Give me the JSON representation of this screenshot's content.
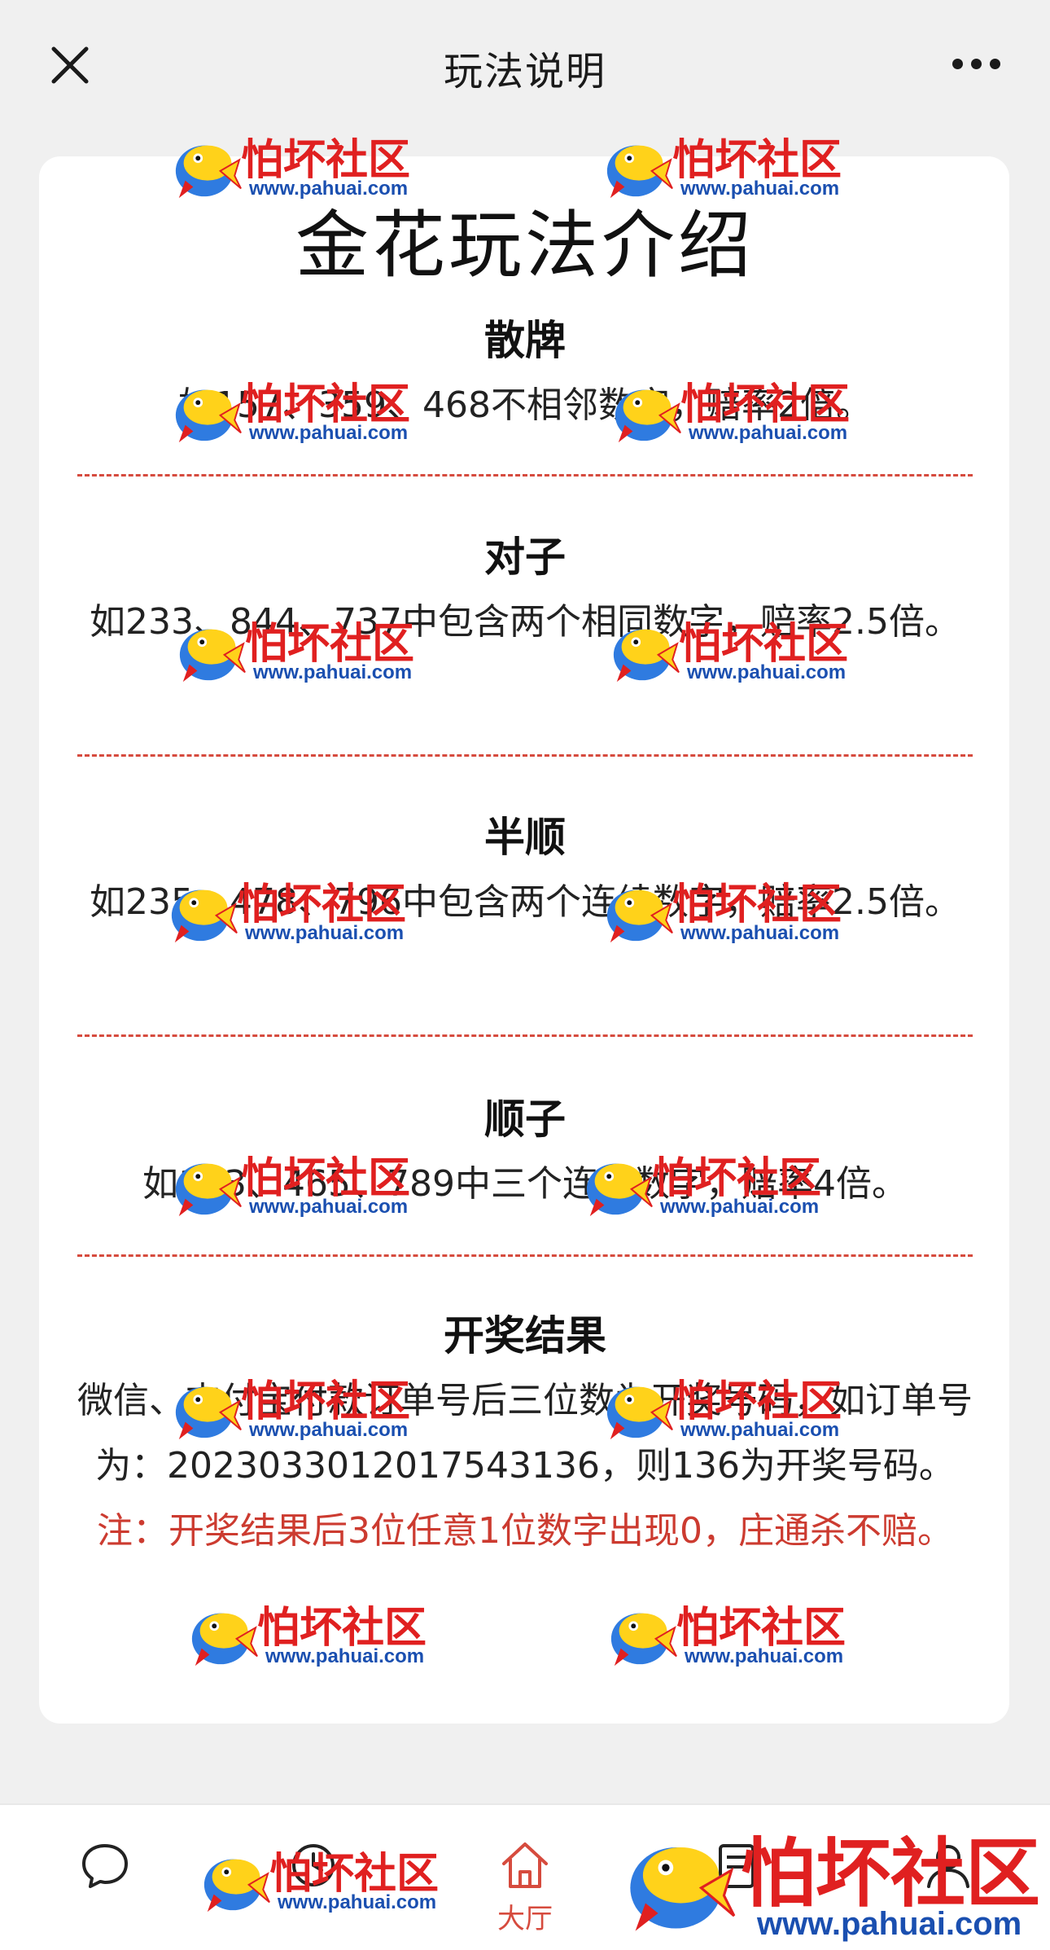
{
  "topbar": {
    "title": "玩法说明"
  },
  "main_title": "金花玩法介绍",
  "sections": [
    {
      "heading": "散牌",
      "body": "如157、359、468不相邻数字，赔率2倍。"
    },
    {
      "heading": "对子",
      "body": "如233、844、737中包含两个相同数字，赔率2.5倍。"
    },
    {
      "heading": "半顺",
      "body": "如235、478、796中包含两个连续数字，赔率2.5倍。"
    },
    {
      "heading": "顺子",
      "body": "如123、465、789中三个连续数字，赔率4倍。"
    },
    {
      "heading": "开奖结果",
      "body": "微信、支付宝付款订单号后三位数为开奖号码，如订单号为：2023033012017543136，则136为开奖号码。",
      "note": "注：开奖结果后3位任意1位数字出现0，庄通杀不赔。"
    }
  ],
  "tabbar": {
    "items": [
      {
        "icon": "chat-icon",
        "label": ""
      },
      {
        "icon": "clock-icon",
        "label": ""
      },
      {
        "icon": "home-icon",
        "label": "大厅"
      },
      {
        "icon": "record-icon",
        "label": ""
      },
      {
        "icon": "user-icon",
        "label": ""
      }
    ],
    "active_color": "#d64b3e"
  },
  "watermark": {
    "text": "怕坏社区",
    "url": "www.pahuai.com"
  }
}
